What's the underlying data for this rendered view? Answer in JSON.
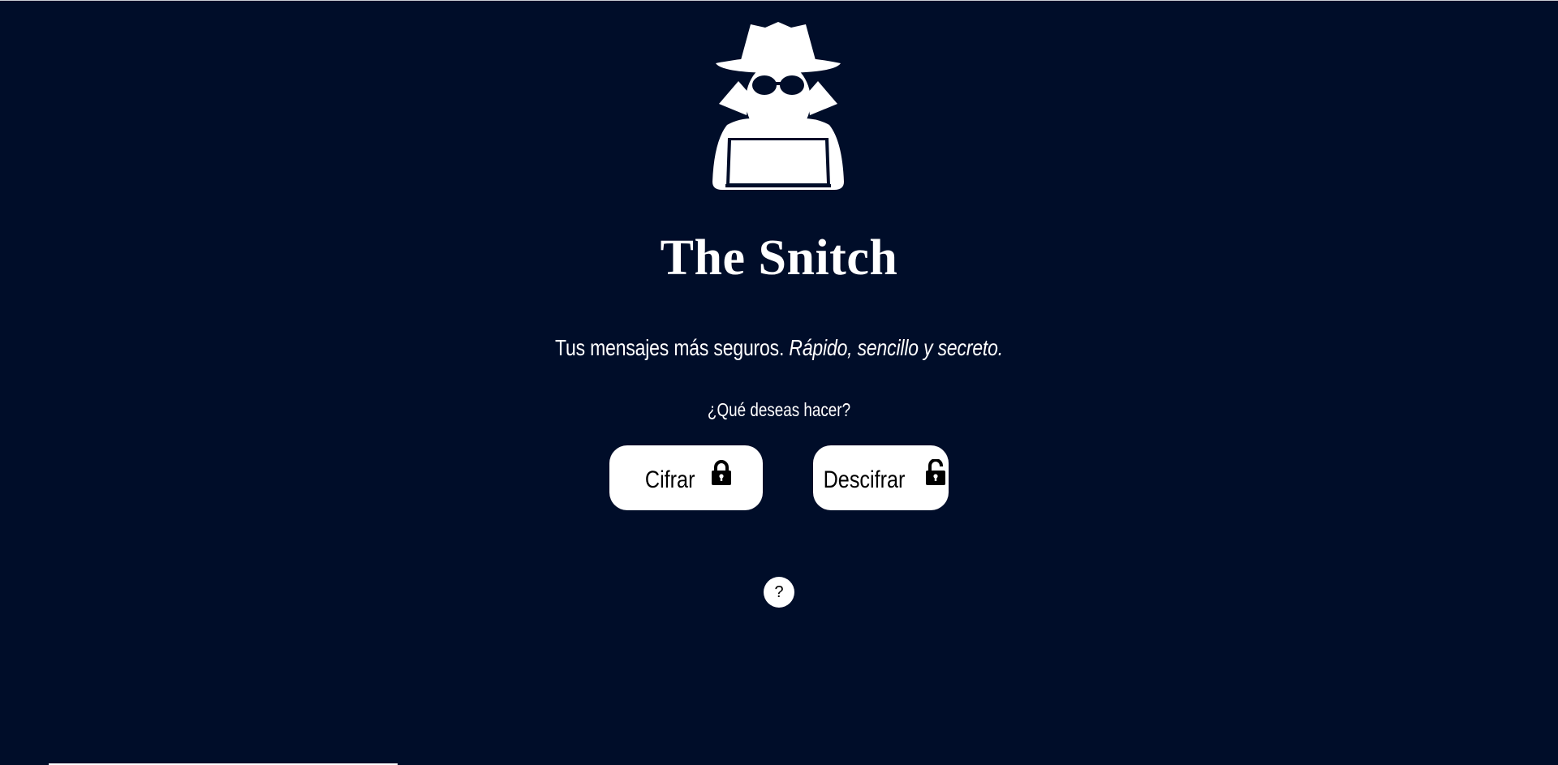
{
  "app": {
    "title": "The Snitch",
    "logo_icon": "spy-with-laptop-icon"
  },
  "tagline": {
    "plain": "Tus mensajes más seguros.",
    "emphasis": "Rápido, sencillo y secreto."
  },
  "prompt": {
    "question": "¿Qué deseas hacer?"
  },
  "actions": {
    "encrypt": {
      "label": "Cifrar",
      "icon": "lock-closed-icon"
    },
    "decrypt": {
      "label": "Descifrar",
      "icon": "lock-open-icon"
    }
  },
  "help": {
    "label": "?"
  },
  "colors": {
    "background": "#000d29",
    "foreground": "#ffffff",
    "button_text": "#000000"
  }
}
